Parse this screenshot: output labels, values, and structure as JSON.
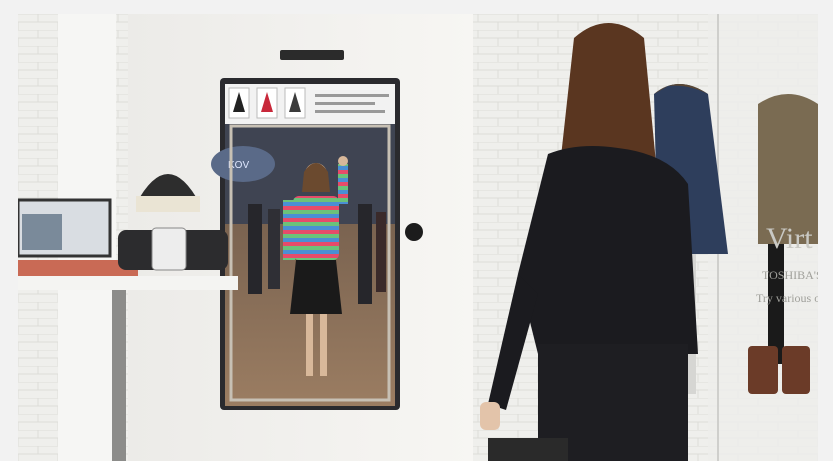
{
  "scene": {
    "description_text_visible": {
      "storefront_text_line1": "Virt",
      "storefront_text_line2": "TOSHIBA'S",
      "storefront_text_line3": "Try various o",
      "mirror_ui_logo": "KOV"
    },
    "colors": {
      "wall_brick": "#eeeeec",
      "mirror_panel": "#f4f3f1",
      "screen_frame": "#2a2a2e",
      "jacket_black": "#1b1b1f",
      "hair_brown": "#5a3620"
    }
  }
}
